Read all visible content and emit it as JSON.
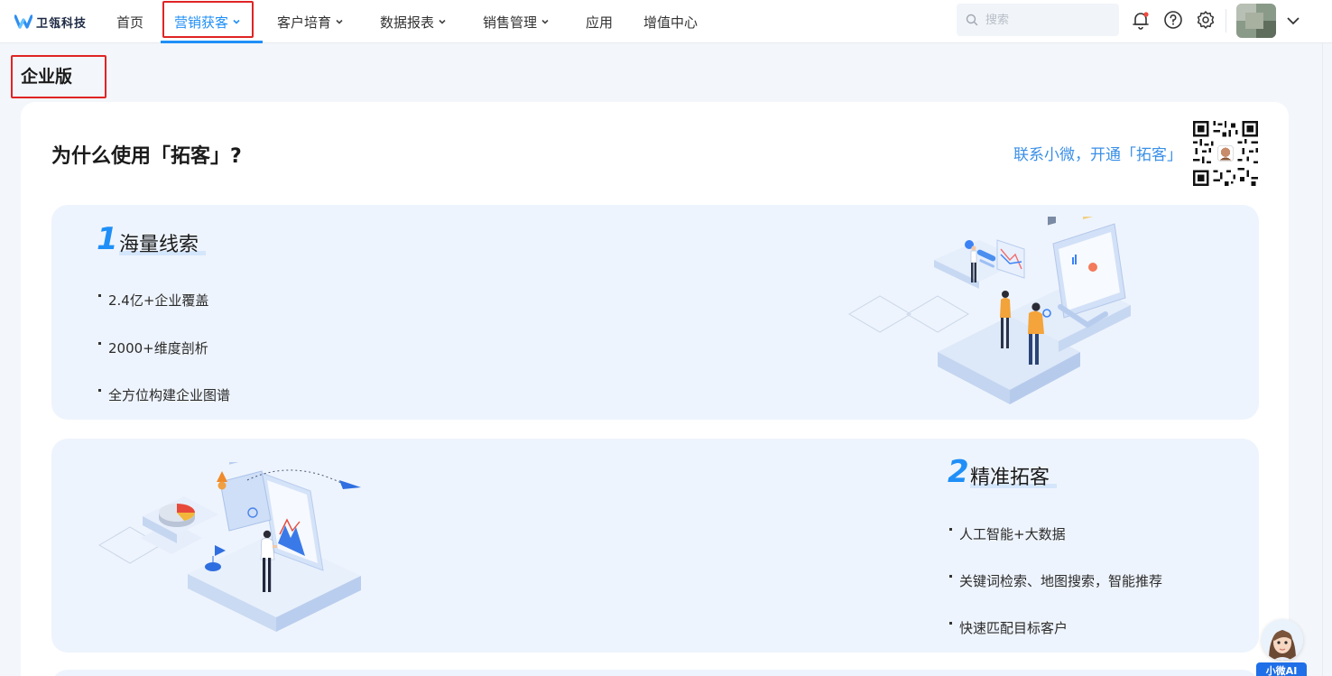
{
  "app": {
    "logo_text": "卫瓴科技",
    "brand_color": "#1f8ff7"
  },
  "nav": {
    "items": [
      {
        "label": "首页",
        "has_dropdown": false,
        "active": false
      },
      {
        "label": "营销获客",
        "has_dropdown": true,
        "active": true
      },
      {
        "label": "客户培育",
        "has_dropdown": true,
        "active": false
      },
      {
        "label": "数据报表",
        "has_dropdown": true,
        "active": false
      },
      {
        "label": "销售管理",
        "has_dropdown": true,
        "active": false
      },
      {
        "label": "应用",
        "has_dropdown": false,
        "active": false
      },
      {
        "label": "增值中心",
        "has_dropdown": false,
        "active": false
      }
    ],
    "search_placeholder": "搜索",
    "icons": [
      "bell-icon",
      "help-icon",
      "settings-icon",
      "chevron-down-icon"
    ]
  },
  "page": {
    "title": "企业版"
  },
  "main": {
    "heading": "为什么使用「拓客」?",
    "contact_text": "联系小微，开通「拓客」",
    "features": [
      {
        "number": "1",
        "title": "海量线索",
        "bullets": [
          "2.4亿+企业覆盖",
          "2000+维度剖析",
          "全方位构建企业图谱"
        ]
      },
      {
        "number": "2",
        "title": "精准拓客",
        "bullets": [
          "人工智能+大数据",
          "关键词检索、地图搜索，智能推荐",
          "快速匹配目标客户"
        ]
      }
    ]
  },
  "assistant": {
    "label": "小微AI"
  }
}
